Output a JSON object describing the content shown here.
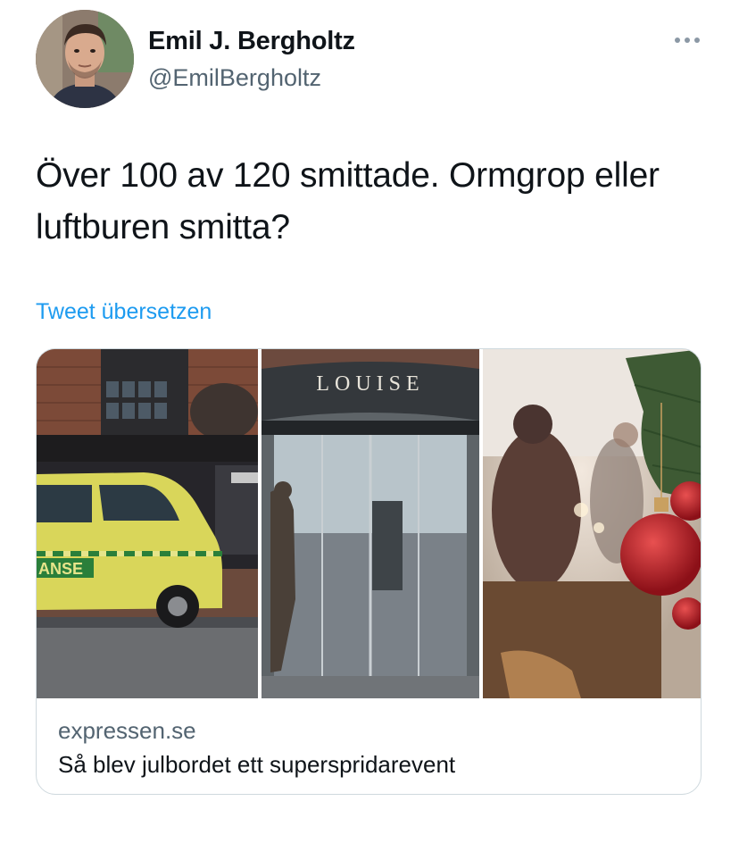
{
  "author": {
    "display_name": "Emil J. Bergholtz",
    "handle": "@EmilBergholtz"
  },
  "tweet": {
    "text": "Över 100 av 120 smittade. Ormgrop eller luftburen smitta?",
    "translate_label": "Tweet übersetzen"
  },
  "card": {
    "domain": "expressen.se",
    "title": "Så blev julbordet ett superspridarevent",
    "images": [
      {
        "description": "ambulance-outside-building",
        "vehicle_text": "ANSE"
      },
      {
        "description": "restaurant-entrance",
        "sign_text": "LOUISE"
      },
      {
        "description": "christmas-dinner"
      }
    ]
  },
  "colors": {
    "text_primary": "#0f1419",
    "text_secondary": "#536471",
    "link": "#1d9bf0",
    "border": "#cfd9de"
  },
  "icons": {
    "more": "more-horizontal-icon"
  }
}
